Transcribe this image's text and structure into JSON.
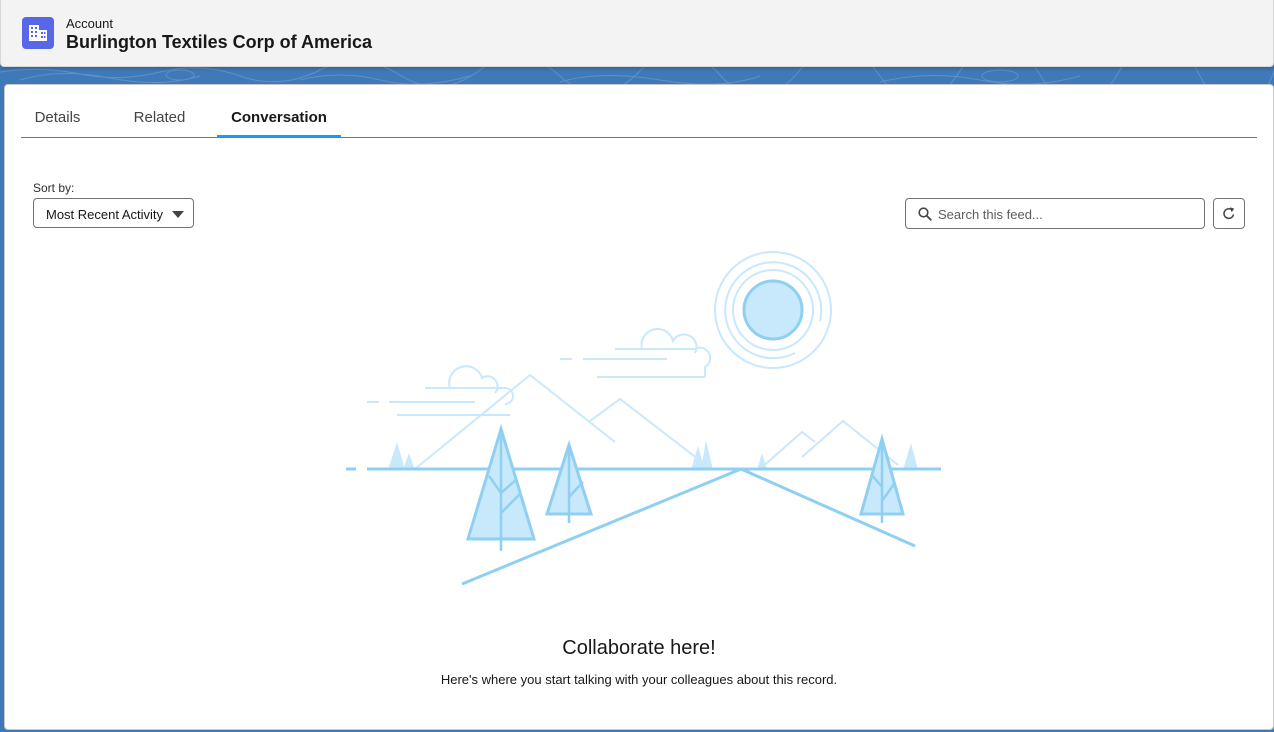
{
  "header": {
    "object_label": "Account",
    "record_title": "Burlington Textiles Corp of America",
    "icon": "building-icon",
    "icon_color": "#5867e8"
  },
  "tabs": [
    {
      "label": "Details",
      "active": false
    },
    {
      "label": "Related",
      "active": false
    },
    {
      "label": "Conversation",
      "active": true
    }
  ],
  "feed": {
    "sort_label": "Sort by:",
    "sort_value": "Most Recent Activity",
    "search_placeholder": "Search this feed...",
    "refresh_icon": "refresh-icon"
  },
  "empty_state": {
    "title": "Collaborate here!",
    "body": "Here's where you start talking with your colleagues about this record."
  },
  "colors": {
    "accent": "#1b96ff",
    "background": "#3f79b8",
    "illustration_stroke": "#8fd0f2",
    "illustration_fill": "#c8e8fb"
  }
}
